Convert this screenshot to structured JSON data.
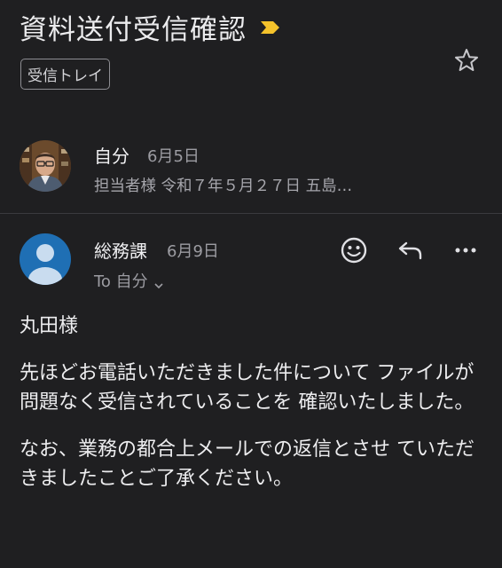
{
  "subject": "資料送付受信確認",
  "label_chip": "受信トレイ",
  "icons": {
    "importance": "importance-marker-icon",
    "star": "star-icon",
    "emoji": "emoji-reaction-icon",
    "reply": "reply-icon",
    "more": "more-options-icon",
    "chevron": "chevron-down-icon"
  },
  "colors": {
    "background": "#1f1f21",
    "importance": "#f4c22b",
    "default_avatar": "#1f6fb4"
  },
  "messages": [
    {
      "sender": "自分",
      "date": "6月5日",
      "snippet": "担当者様 令和７年５月２７日 五島…"
    },
    {
      "sender": "総務課",
      "date": "6月9日",
      "to_line": "To 自分",
      "body": [
        "丸田様",
        "先ほどお電話いただきました件について ファイルが問題なく受信されていることを 確認いたしました。",
        "なお、業務の都合上メールでの返信とさせ ていただきましたことご了承ください。"
      ]
    }
  ]
}
